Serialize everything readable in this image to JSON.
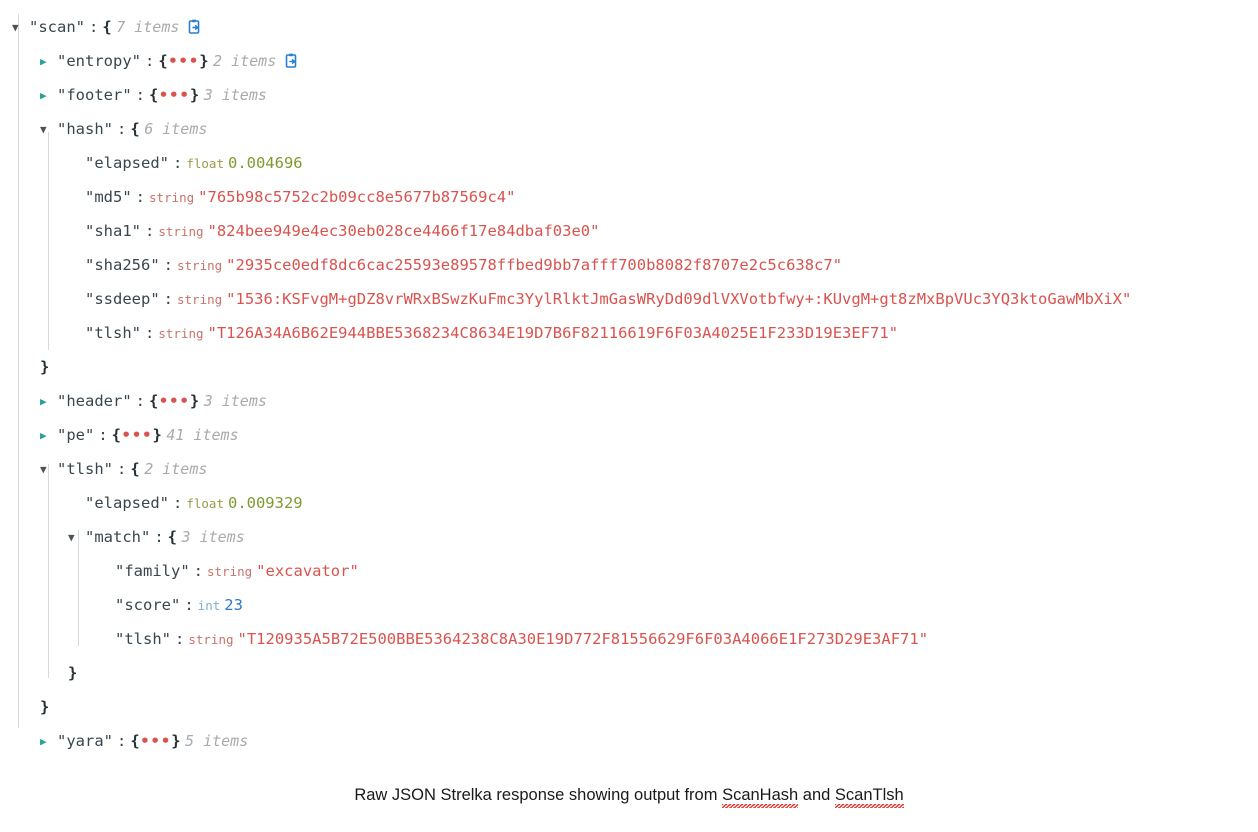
{
  "viewer": {
    "root_key": "\"scan\"",
    "copy_icon": "clipboard-copy-icon",
    "closed_triangle": "▶",
    "open_triangle": "▼",
    "open_brace": "{",
    "close_brace": "}",
    "ellipsis_dots": "•••",
    "colon": ":"
  },
  "rows": [
    {
      "id": "scan",
      "key": "\"scan\"",
      "state": "open",
      "brace": "{",
      "count": "7 items",
      "copy": true,
      "level": 0
    },
    {
      "id": "entropy",
      "key": "\"entropy\"",
      "state": "closed",
      "brace_group": "{•••}",
      "count": "2 items",
      "copy": true,
      "level": 1
    },
    {
      "id": "footer",
      "key": "\"footer\"",
      "state": "closed",
      "brace_group": "{•••}",
      "count": "3 items",
      "copy": false,
      "level": 1
    },
    {
      "id": "hash",
      "key": "\"hash\"",
      "state": "open",
      "brace": "{",
      "count": "6 items",
      "copy": false,
      "level": 1
    },
    {
      "id": "hash-elapsed",
      "key": "\"elapsed\"",
      "type": "float",
      "value": "0.004696",
      "level": 2
    },
    {
      "id": "hash-md5",
      "key": "\"md5\"",
      "type": "string",
      "value": "\"765b98c5752c2b09cc8e5677b87569c4\"",
      "level": 2
    },
    {
      "id": "hash-sha1",
      "key": "\"sha1\"",
      "type": "string",
      "value": "\"824bee949e4ec30eb028ce4466f17e84dbaf03e0\"",
      "level": 2
    },
    {
      "id": "hash-sha256",
      "key": "\"sha256\"",
      "type": "string",
      "value": "\"2935ce0edf8dc6cac25593e89578ffbed9bb7afff700b8082f8707e2c5c638c7\"",
      "level": 2
    },
    {
      "id": "hash-ssdeep",
      "key": "\"ssdeep\"",
      "type": "string",
      "value": "\"1536:KSFvgM+gDZ8vrWRxBSwzKuFmc3YylRlktJmGasWRyDd09dlVXVotbfwy+:KUvgM+gt8zMxBpVUc3YQ3ktoGawMbXiX\"",
      "level": 2
    },
    {
      "id": "hash-tlsh",
      "key": "\"tlsh\"",
      "type": "string",
      "value": "\"T126A34A6B62E944BBE5368234C8634E19D7B6F82116619F6F03A4025E1F233D19E3EF71\"",
      "level": 2
    },
    {
      "id": "hash-close",
      "close_brace": "}",
      "level": 1
    },
    {
      "id": "header",
      "key": "\"header\"",
      "state": "closed",
      "brace_group": "{•••}",
      "count": "3 items",
      "copy": false,
      "level": 1
    },
    {
      "id": "pe",
      "key": "\"pe\"",
      "state": "closed",
      "brace_group": "{•••}",
      "count": "41 items",
      "copy": false,
      "level": 1
    },
    {
      "id": "tlsh",
      "key": "\"tlsh\"",
      "state": "open",
      "brace": "{",
      "count": "2 items",
      "copy": false,
      "level": 1
    },
    {
      "id": "tlsh-elapsed",
      "key": "\"elapsed\"",
      "type": "float",
      "value": "0.009329",
      "level": 2
    },
    {
      "id": "tlsh-match",
      "key": "\"match\"",
      "state": "open",
      "brace": "{",
      "count": "3 items",
      "copy": false,
      "level": 2
    },
    {
      "id": "match-family",
      "key": "\"family\"",
      "type": "string",
      "value": "\"excavator\"",
      "level": 3
    },
    {
      "id": "match-score",
      "key": "\"score\"",
      "type": "int",
      "value": "23",
      "level": 3
    },
    {
      "id": "match-tlsh",
      "key": "\"tlsh\"",
      "type": "string",
      "value": "\"T120935A5B72E500BBE5364238C8A30E19D772F81556629F6F03A4066E1F273D29E3AF71\"",
      "level": 3
    },
    {
      "id": "match-close",
      "close_brace": "}",
      "level": 2
    },
    {
      "id": "tlsh-close",
      "close_brace": "}",
      "level": 1
    },
    {
      "id": "yara",
      "key": "\"yara\"",
      "state": "closed",
      "brace_group": "{•••}",
      "count": "5 items",
      "copy": false,
      "level": 1
    }
  ],
  "caption": {
    "part1": "Raw JSON Strelka response showing output from ",
    "misspelled1": "ScanHash",
    "part2": " and ",
    "misspelled2": "ScanTlsh"
  },
  "colors": {
    "key": "#37474f",
    "string_value": "#d9534f",
    "float_value": "#7d9b2f",
    "int_value": "#2b7cc4",
    "type_string": "#c9736c",
    "type_float": "#9a9a4a",
    "type_int": "#7eaed4",
    "count": "#a8aaac",
    "closed_triangle": "#2aa198",
    "open_triangle": "#4a5358",
    "rail": "#d7dadc",
    "copy_icon": "#2a7fd4",
    "spellcheck_underline": "#e53935"
  }
}
